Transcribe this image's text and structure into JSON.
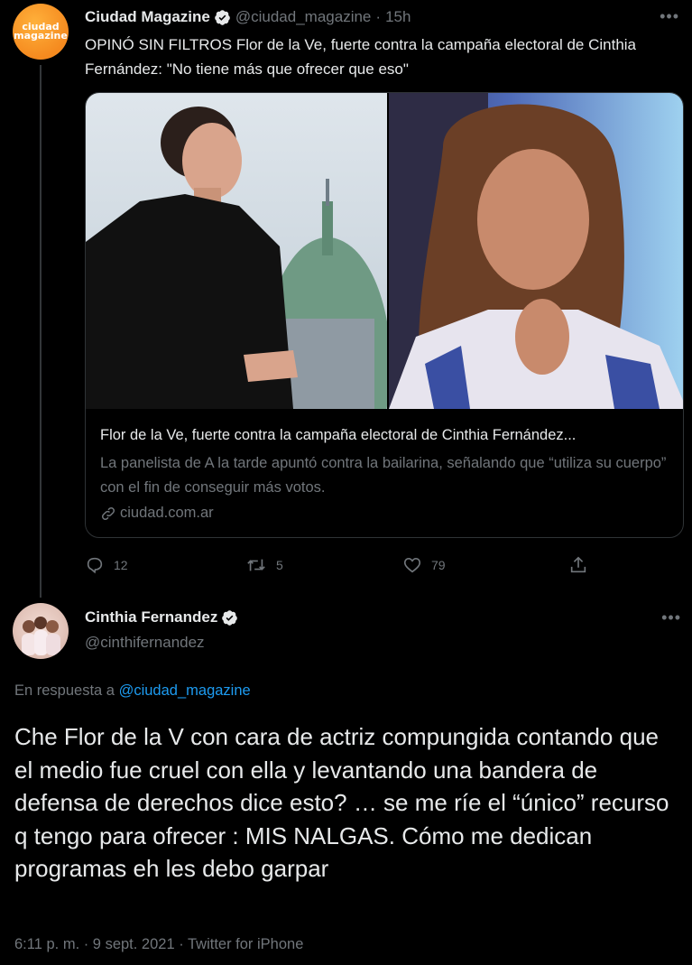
{
  "tweet1": {
    "avatar_text": "ciudad magazine",
    "name": "Ciudad Magazine",
    "handle": "@ciudad_magazine",
    "time": "15h",
    "text": "OPINÓ SIN FILTROS Flor de la Ve, fuerte contra la campaña electoral de Cinthia Fernández: \"No tiene más que ofrecer que eso\"",
    "card": {
      "title": "Flor de la Ve, fuerte contra la campaña electoral de Cinthia Fernández...",
      "description": "La panelista de A la tarde apuntó contra la bailarina, señalando que “utiliza su cuerpo” con el fin de conseguir más votos.",
      "domain": "ciudad.com.ar"
    },
    "actions": {
      "replies": "12",
      "retweets": "5",
      "likes": "79"
    }
  },
  "tweet2": {
    "name": "Cinthia Fernandez",
    "handle": "@cinthifernandez",
    "reply_prefix": "En respuesta a",
    "reply_mention": "@ciudad_magazine",
    "text": "Che Flor de la V con cara de actriz compungida contando que el medio fue cruel con ella y levantando una bandera de defensa de derechos dice esto? … se me ríe el “único” recurso q tengo para ofrecer : MIS NALGAS. Cómo me dedican programas eh les debo garpar",
    "timestamp": "6:11 p. m. · 9 sept. 2021 · Twitter for iPhone"
  },
  "colors": {
    "background": "#000000",
    "text": "#e7e9ea",
    "secondary": "#71767b",
    "accent": "#1d9bf0",
    "border": "#2f3336"
  }
}
